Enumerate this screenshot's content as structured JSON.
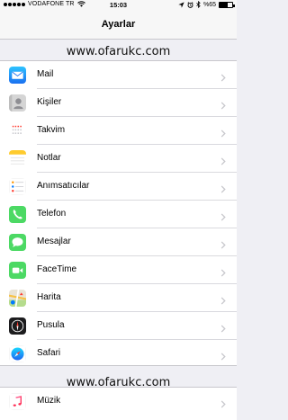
{
  "status_bar": {
    "carrier": "VODAFONE TR",
    "time": "15:03",
    "battery_text": "%65",
    "battery_level": 0.65
  },
  "nav": {
    "title": "Ayarlar"
  },
  "watermark_top": "www.ofarukc.com",
  "watermark_bottom": "www.ofarukc.com",
  "settings_group_1": [
    {
      "label": "Mail",
      "icon": "mail-icon"
    },
    {
      "label": "Kişiler",
      "icon": "contacts-icon"
    },
    {
      "label": "Takvim",
      "icon": "calendar-icon"
    },
    {
      "label": "Notlar",
      "icon": "notes-icon"
    },
    {
      "label": "Anımsatıcılar",
      "icon": "reminders-icon"
    },
    {
      "label": "Telefon",
      "icon": "phone-icon"
    },
    {
      "label": "Mesajlar",
      "icon": "messages-icon"
    },
    {
      "label": "FaceTime",
      "icon": "facetime-icon"
    },
    {
      "label": "Harita",
      "icon": "maps-icon"
    },
    {
      "label": "Pusula",
      "icon": "compass-icon"
    },
    {
      "label": "Safari",
      "icon": "safari-icon"
    }
  ],
  "settings_group_2": [
    {
      "label": "Müzik",
      "icon": "music-icon"
    }
  ]
}
